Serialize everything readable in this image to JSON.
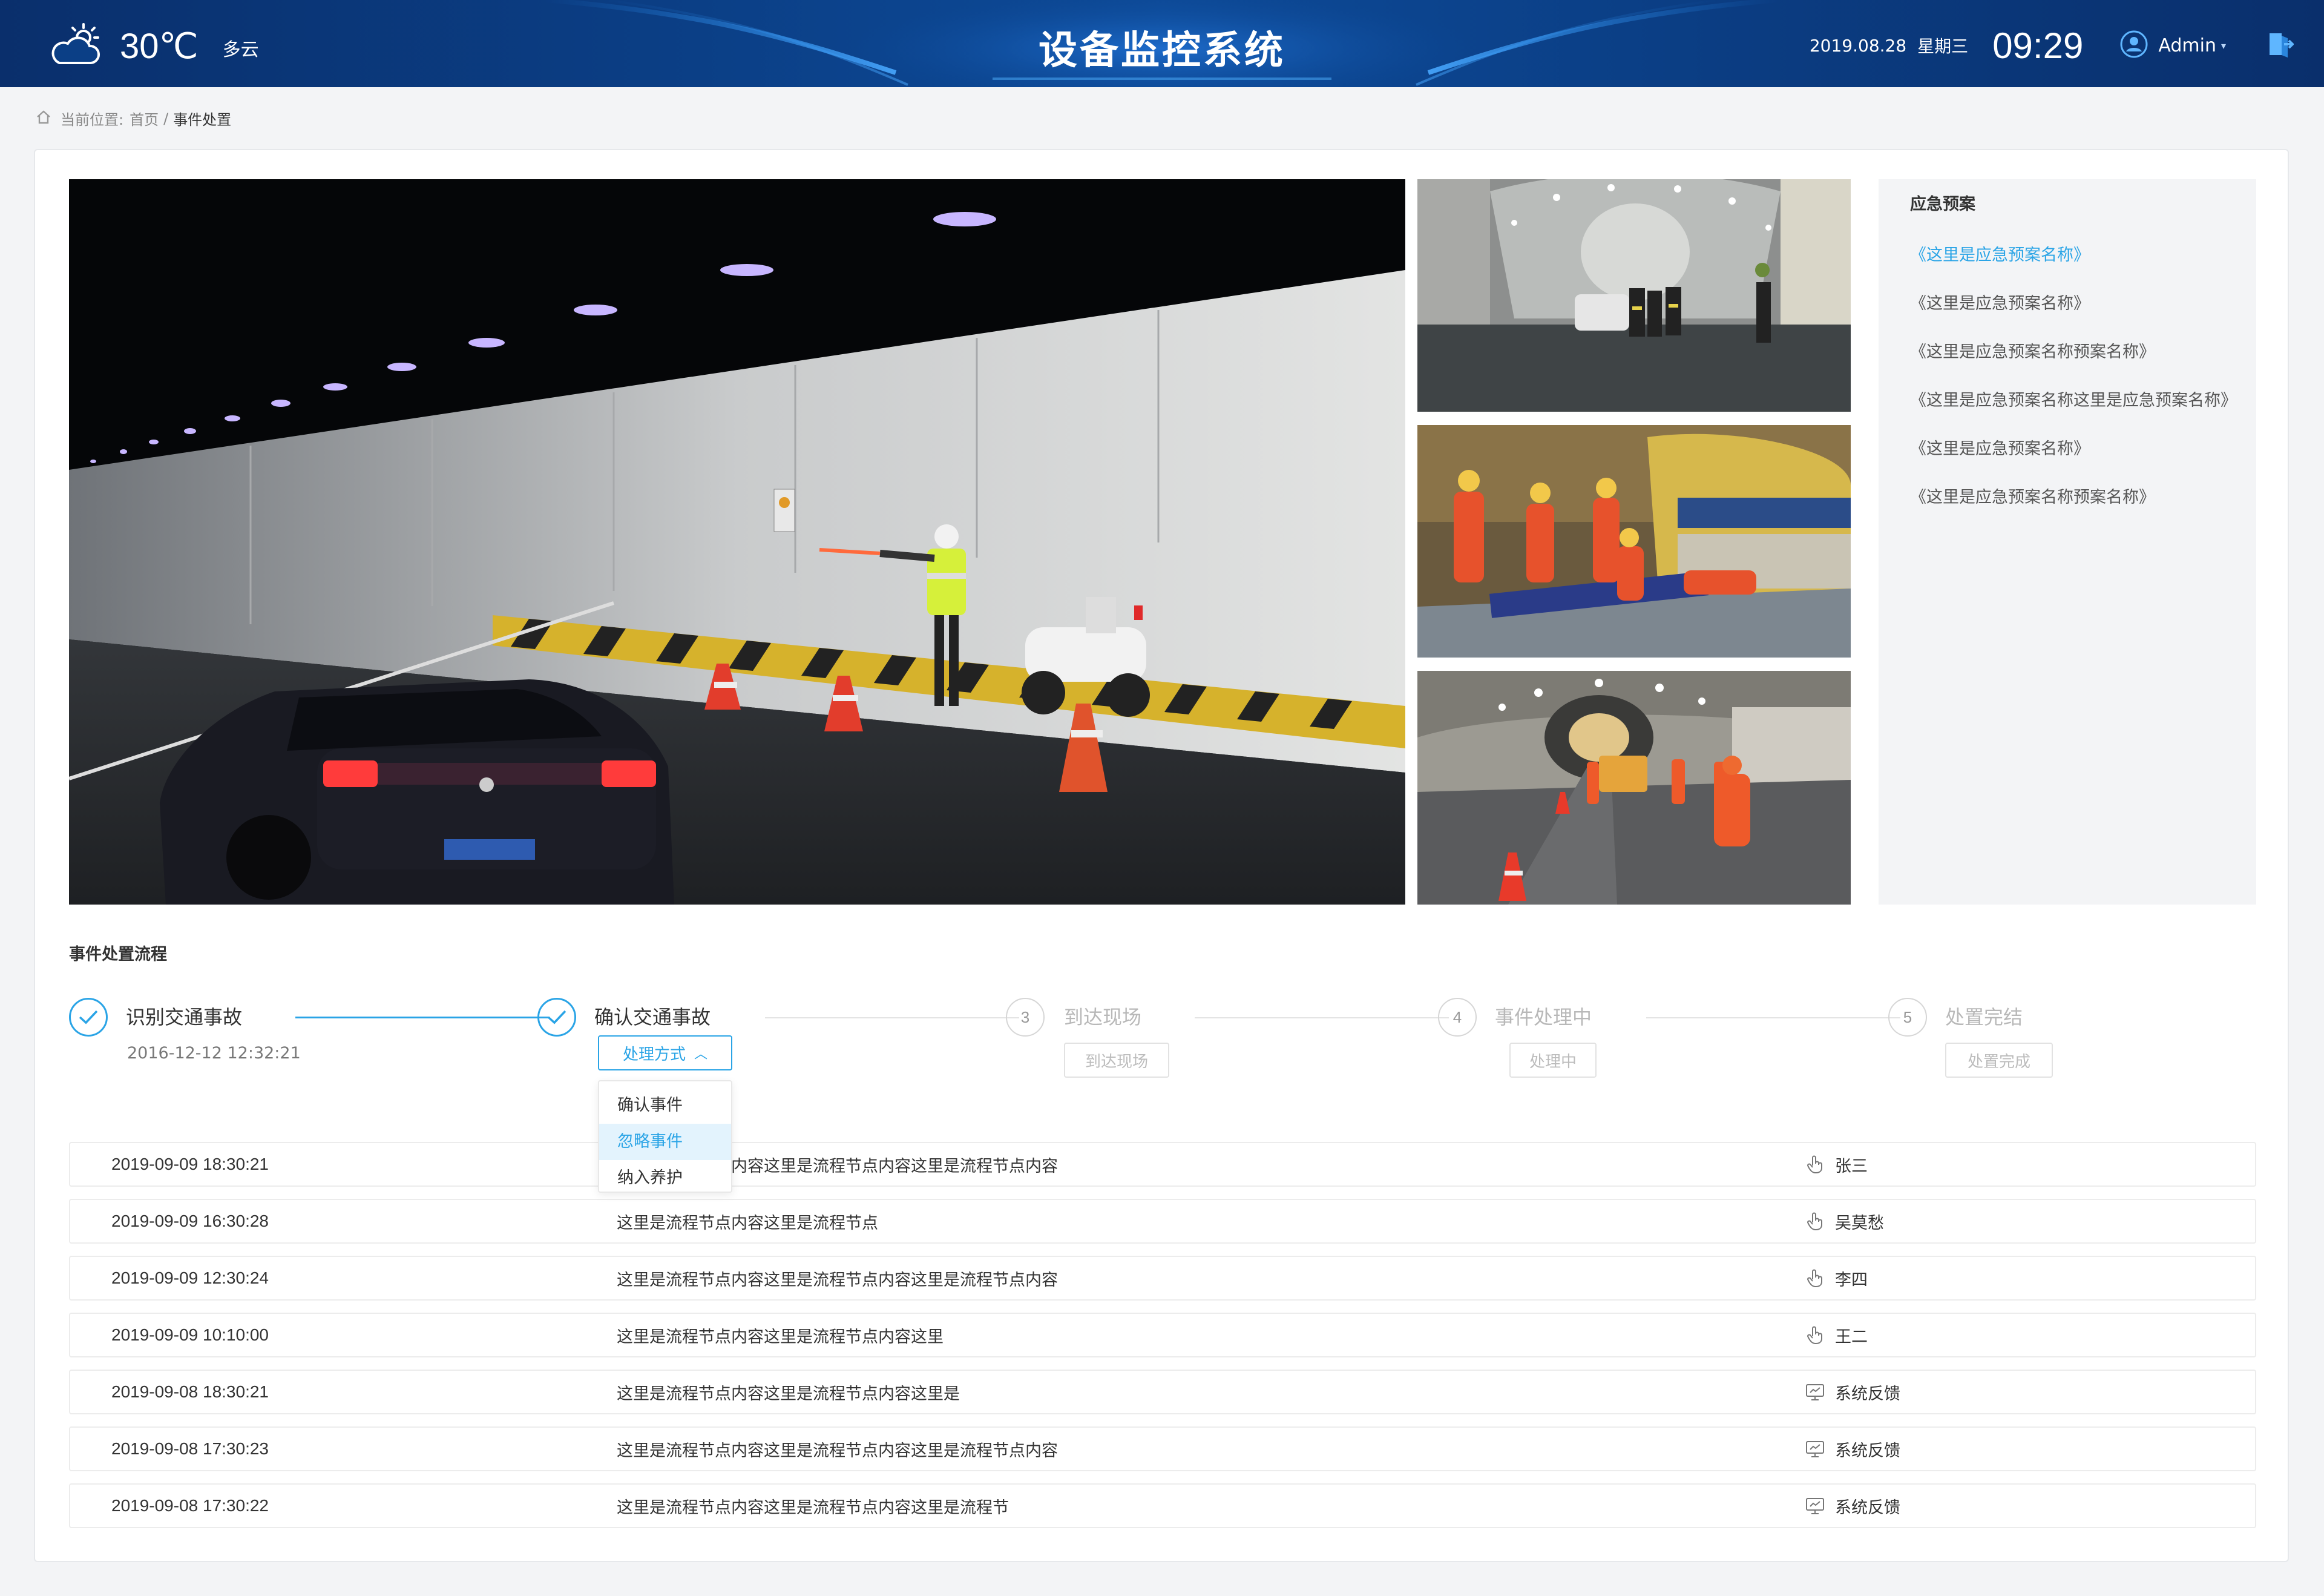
{
  "header": {
    "temperature": "30℃",
    "weather": "多云",
    "title": "设备监控系统",
    "date": "2019.08.28",
    "weekday": "星期三",
    "time": "09:29",
    "user": "Admin"
  },
  "breadcrumb": {
    "prefix": "当前位置:",
    "home": "首页",
    "separator": "/",
    "current": "事件处置"
  },
  "plan_panel": {
    "title": "应急预案",
    "items": [
      "《这里是应急预案名称》",
      "《这里是应急预案名称》",
      "《这里是应急预案名称预案名称》",
      "《这里是应急预案名称这里是应急预案名称》",
      "《这里是应急预案名称》",
      "《这里是应急预案名称预案名称》"
    ]
  },
  "process": {
    "title": "事件处置流程",
    "steps": [
      {
        "label": "识别交通事故",
        "status": "done",
        "time": "2016-12-12 12:32:21"
      },
      {
        "label": "确认交通事故",
        "status": "done",
        "button": "处理方式"
      },
      {
        "label": "到达现场",
        "status": "todo",
        "number": "3",
        "button": "到达现场"
      },
      {
        "label": "事件处理中",
        "status": "todo",
        "number": "4",
        "button": "处理中"
      },
      {
        "label": "处置完结",
        "status": "todo",
        "number": "5",
        "button": "处置完成"
      }
    ],
    "dropdown_options": [
      "确认事件",
      "忽略事件",
      "纳入养护"
    ],
    "dropdown_hover_index": 1
  },
  "events": [
    {
      "time": "2019-09-09 18:30:21",
      "content": "这里是流程节点内容这里是流程节点内容这里是流程节点内容",
      "user": "张三",
      "source": "hand-icon"
    },
    {
      "time": "2019-09-09 16:30:28",
      "content": "这里是流程节点内容这里是流程节点",
      "user": "吴莫愁",
      "source": "hand-icon"
    },
    {
      "time": "2019-09-09 12:30:24",
      "content": "这里是流程节点内容这里是流程节点内容这里是流程节点内容",
      "user": "李四",
      "source": "hand-icon"
    },
    {
      "time": "2019-09-09 10:10:00",
      "content": "这里是流程节点内容这里是流程节点内容这里",
      "user": "王二",
      "source": "hand-icon"
    },
    {
      "time": "2019-09-08 18:30:21",
      "content": "这里是流程节点内容这里是流程节点内容这里是",
      "user": "系统反馈",
      "source": "monitor-icon"
    },
    {
      "time": "2019-09-08 17:30:23",
      "content": "这里是流程节点内容这里是流程节点内容这里是流程节点内容",
      "user": "系统反馈",
      "source": "monitor-icon"
    },
    {
      "time": "2019-09-08 17:30:22",
      "content": "这里是流程节点内容这里是流程节点内容这里是流程节",
      "user": "系统反馈",
      "source": "monitor-icon"
    }
  ],
  "colors": {
    "accent": "#2aa4e6",
    "header_bg": "#0b3f86",
    "panel_bg": "#f3f4f6"
  }
}
